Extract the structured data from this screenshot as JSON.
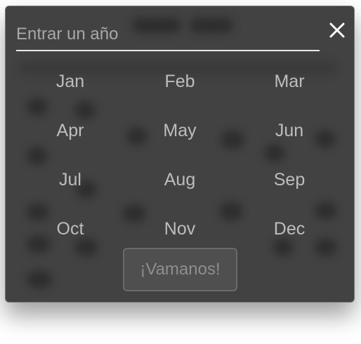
{
  "year_picker": {
    "input": {
      "value": "",
      "placeholder": "Entrar un año"
    },
    "close_icon": "close-icon",
    "months": [
      {
        "label": "Jan"
      },
      {
        "label": "Feb"
      },
      {
        "label": "Mar"
      },
      {
        "label": "Apr"
      },
      {
        "label": "May"
      },
      {
        "label": "Jun"
      },
      {
        "label": "Jul"
      },
      {
        "label": "Aug"
      },
      {
        "label": "Sep"
      },
      {
        "label": "Oct"
      },
      {
        "label": "Nov"
      },
      {
        "label": "Dec"
      }
    ],
    "submit_label": "¡Vamanos!"
  },
  "colors": {
    "panel": "#424242",
    "month_text": "#bdbdbd",
    "button_text": "#8e8e8e"
  }
}
